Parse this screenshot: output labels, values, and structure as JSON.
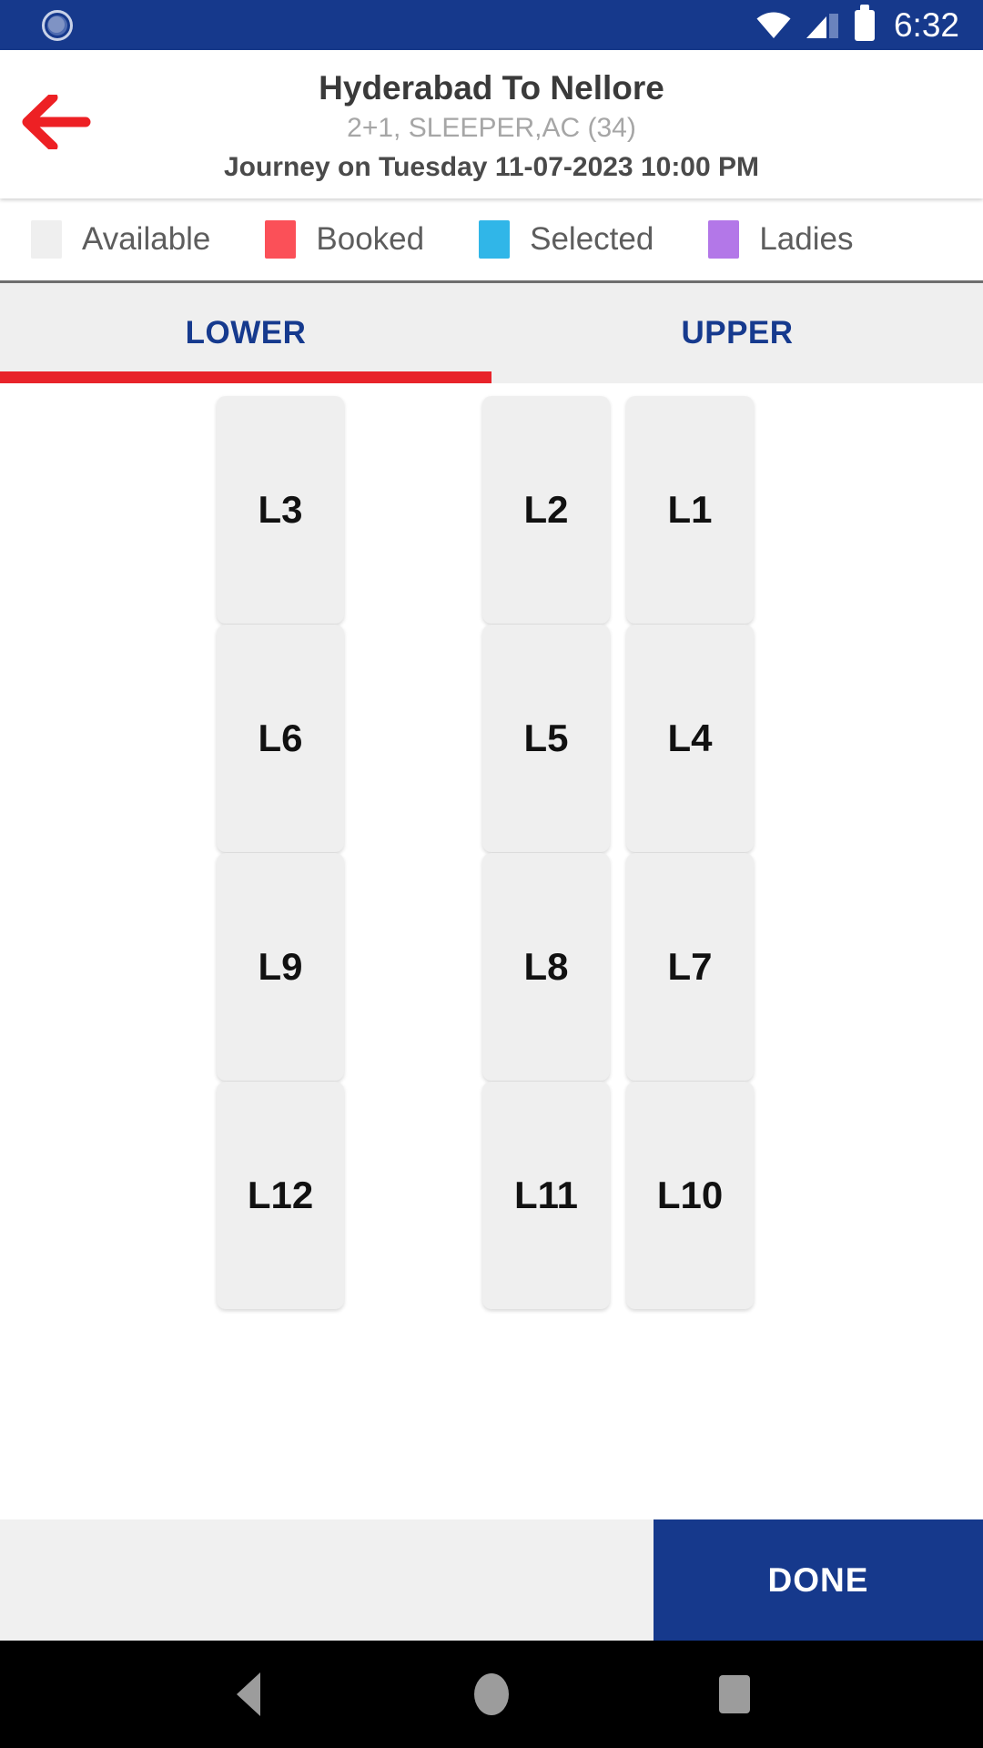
{
  "status_bar": {
    "sync_icon": "sync-icon",
    "wifi_icon": "wifi-icon",
    "signal_icon": "signal-icon",
    "battery_icon": "battery-icon",
    "clock": "6:32",
    "background_color": "#16398c"
  },
  "header": {
    "back_icon": "back-arrow-icon",
    "back_icon_color": "#ed2024",
    "title": "Hyderabad To Nellore",
    "subtitle": "2+1, SLEEPER,AC (34)",
    "journey": "Journey on Tuesday 11-07-2023  10:00 PM"
  },
  "legend": {
    "items": [
      {
        "label": "Available",
        "color": "#efefef"
      },
      {
        "label": "Booked",
        "color": "#fb5058"
      },
      {
        "label": "Selected",
        "color": "#30b6e8"
      },
      {
        "label": "Ladies",
        "color": "#b377e8"
      }
    ]
  },
  "tabs": {
    "items": [
      {
        "label": "LOWER",
        "active": true
      },
      {
        "label": "UPPER",
        "active": false
      }
    ],
    "active_color": "#163a8e",
    "indicator_color": "#e8232a"
  },
  "seat_map": {
    "deck": "LOWER",
    "rows": [
      {
        "left": [
          {
            "label": "L3",
            "state": "available"
          }
        ],
        "right": [
          {
            "label": "L2",
            "state": "available"
          },
          {
            "label": "L1",
            "state": "available"
          }
        ]
      },
      {
        "left": [
          {
            "label": "L6",
            "state": "available"
          }
        ],
        "right": [
          {
            "label": "L5",
            "state": "available"
          },
          {
            "label": "L4",
            "state": "available"
          }
        ]
      },
      {
        "left": [
          {
            "label": "L9",
            "state": "available"
          }
        ],
        "right": [
          {
            "label": "L8",
            "state": "available"
          },
          {
            "label": "L7",
            "state": "available"
          }
        ]
      },
      {
        "left": [
          {
            "label": "L12",
            "state": "available"
          }
        ],
        "right": [
          {
            "label": "L11",
            "state": "available"
          },
          {
            "label": "L10",
            "state": "available"
          }
        ]
      }
    ]
  },
  "bottom_bar": {
    "done_label": "DONE",
    "done_color": "#16398c"
  },
  "nav_bar": {
    "back_icon": "nav-back-icon",
    "home_icon": "nav-home-icon",
    "recents_icon": "nav-recents-icon"
  }
}
